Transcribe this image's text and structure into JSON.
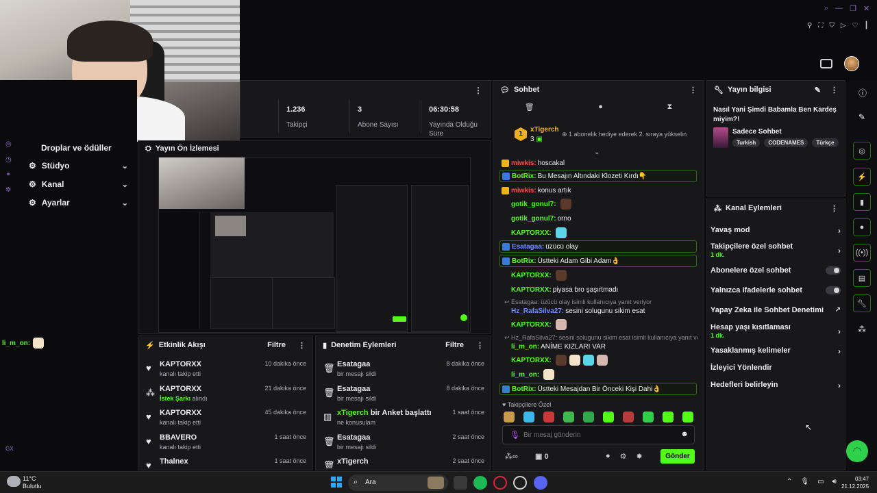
{
  "webcam": {
    "caption": ""
  },
  "sidebar": {
    "items": [
      {
        "label": "Droplar ve ödüller",
        "icon": "gift-icon"
      },
      {
        "label": "Stüdyo",
        "icon": "studio-icon"
      },
      {
        "label": "Kanal",
        "icon": "channel-icon"
      },
      {
        "label": "Ayarlar",
        "icon": "gear-icon"
      }
    ],
    "bottom_tag": "GX"
  },
  "overlay_chat": {
    "user": "li_m_on:"
  },
  "stats": [
    {
      "value": "1.236",
      "label": "Takipçi"
    },
    {
      "value": "3",
      "label": "Abone Sayısı"
    },
    {
      "value": "06:30:58",
      "label": "Yayında Olduğu Süre"
    }
  ],
  "preview": {
    "title": "Yayın Ön İzlemesi"
  },
  "activity": {
    "title": "Etkinlik Akışı",
    "filter": "Filtre",
    "items": [
      {
        "name": "KAPTORXX",
        "sub": "kanalı takip etti",
        "time": "10 dakika önce",
        "icon": "heart-icon",
        "green": false
      },
      {
        "name": "KAPTORXX",
        "sub": "İstek Şarkı",
        "sub2": "alındı",
        "time": "21 dakika önce",
        "icon": "kick-points-icon",
        "green": true
      },
      {
        "name": "KAPTORXX",
        "sub": "kanalı takip etti",
        "time": "45 dakika önce",
        "icon": "heart-icon",
        "green": false
      },
      {
        "name": "BBAVERO",
        "sub": "kanalı takip etti",
        "time": "1 saat önce",
        "icon": "heart-icon",
        "green": false
      },
      {
        "name": "Thalnex",
        "sub": "",
        "time": "1 saat önce",
        "icon": "heart-icon",
        "green": false
      }
    ]
  },
  "moderation": {
    "title": "Denetim Eylemleri",
    "filter": "Filtre",
    "items": [
      {
        "name": "Esatagaa",
        "sub": "bir mesajı sildi",
        "time": "8 dakika önce",
        "icon": "trash-icon"
      },
      {
        "name": "Esatagaa",
        "sub": "bir mesajı sildi",
        "time": "8 dakika önce",
        "icon": "trash-icon"
      },
      {
        "name": "xTigerch",
        "name_rest": "bir Anket başlattı",
        "sub": "ne konusulam",
        "time": "1 saat önce",
        "icon": "poll-icon"
      },
      {
        "name": "Esatagaa",
        "sub": "bir mesajı sildi",
        "time": "2 saat önce",
        "icon": "trash-icon"
      },
      {
        "name": "xTigerch",
        "sub": "",
        "time": "2 saat önce",
        "icon": "trash-icon"
      }
    ]
  },
  "chat": {
    "title": "Sohbet",
    "top_gifter": {
      "name": "xTigerch",
      "count": "3",
      "rank": "1"
    },
    "pinned_note": "1 abonelik hediye ederek 2. sıraya yükselin",
    "messages": [
      {
        "user": "miwkis",
        "text": "hoscakal",
        "color": "#ff4d4d",
        "bot": false
      },
      {
        "user": "BotRix",
        "text": "Bu Mesajın Altındaki Klozeti Kırdı👇",
        "color": "#53fc18",
        "bot": true
      },
      {
        "user": "miwkis",
        "text": "konus artık",
        "color": "#ff4d4d",
        "bot": false
      },
      {
        "user": "gotik_gonul7",
        "text": "",
        "color": "#53fc18",
        "bot": false
      },
      {
        "user": "gotik_gonul7",
        "text": "orno",
        "color": "#53fc18",
        "bot": false
      },
      {
        "user": "KAPTORXX",
        "text": "",
        "color": "#53fc18",
        "bot": false
      },
      {
        "user": "Esatagaa",
        "text": "üzücü olay",
        "color": "#6f8cff",
        "bot": true
      },
      {
        "user": "BotRix",
        "text": "Üstteki Adam Gibi Adam👌",
        "color": "#53fc18",
        "bot": true
      },
      {
        "user": "KAPTORXX",
        "text": "",
        "color": "#53fc18",
        "bot": false
      },
      {
        "user": "KAPTORXX",
        "text": "piyasa bro şaşırtmadı",
        "color": "#53fc18",
        "bot": false
      },
      {
        "user": "Hz_RafaSilva27",
        "text": "sesini solugunu sikim esat",
        "color": "#6f8cff",
        "bot": false
      },
      {
        "user": "KAPTORXX",
        "text": "",
        "color": "#53fc18",
        "bot": false
      },
      {
        "user": "li_m_on",
        "text": "ANİME KIZLARI VAR",
        "color": "#53fc18",
        "bot": false
      },
      {
        "user": "KAPTORXX",
        "text": "",
        "color": "#53fc18",
        "bot": false
      },
      {
        "user": "li_m_on",
        "text": "",
        "color": "#53fc18",
        "bot": false
      },
      {
        "user": "BotRix",
        "text": "Üstteki Mesajdan Bir Önceki Kişi Dahi👌",
        "color": "#53fc18",
        "bot": true
      }
    ],
    "replies": [
      "Esatagaa: üzücü olay isimli kullanıcıya yanıt veriyor",
      "Hz_RafaSilva27: sesini solugunu sikim esat isimli kullanıcıya yanıt ve..."
    ],
    "followers_only_label": "Takipçilere Özel",
    "input_placeholder": "Bir mesaj gönderin",
    "points": "0",
    "send_label": "Gönder"
  },
  "stream_info": {
    "title": "Yayın bilgisi",
    "stream_title": "Nasıl Yani Şimdi Babamla Ben Kardeş miyim?!",
    "category": "Sadece Sohbet",
    "tags": [
      "Turkish",
      "CODENAMES",
      "Türkçe"
    ]
  },
  "channel_actions": {
    "title": "Kanal Eylemleri",
    "items": [
      {
        "label": "Yavaş mod",
        "sub": "",
        "control": "chevron"
      },
      {
        "label": "Takipçilere özel sohbet",
        "sub": "1 dk.",
        "control": "chevron"
      },
      {
        "label": "Abonelere özel sohbet",
        "sub": "",
        "control": "toggle"
      },
      {
        "label": "Yalnızca ifadelerle sohbet",
        "sub": "",
        "control": "toggle"
      },
      {
        "label": "Yapay Zeka ile Sohbet Denetimi",
        "sub": "",
        "control": "external"
      },
      {
        "label": "Hesap yaşı kısıtlaması",
        "sub": "1 dk.",
        "control": "chevron"
      },
      {
        "label": "Yasaklanmış kelimeler",
        "sub": "",
        "control": "chevron"
      },
      {
        "label": "İzleyici Yönlendir",
        "sub": "",
        "control": "none"
      },
      {
        "label": "Hedefleri belirleyin",
        "sub": "",
        "control": "chevron"
      }
    ]
  },
  "taskbar": {
    "weather_temp": "11°C",
    "weather_desc": "Bulutlu",
    "search_label": "Ara",
    "time": "03:47",
    "date": "21.12.2025"
  },
  "colors": {
    "accent": "#53fc18",
    "panel": "#18181b",
    "bg": "#0b0b0d"
  }
}
